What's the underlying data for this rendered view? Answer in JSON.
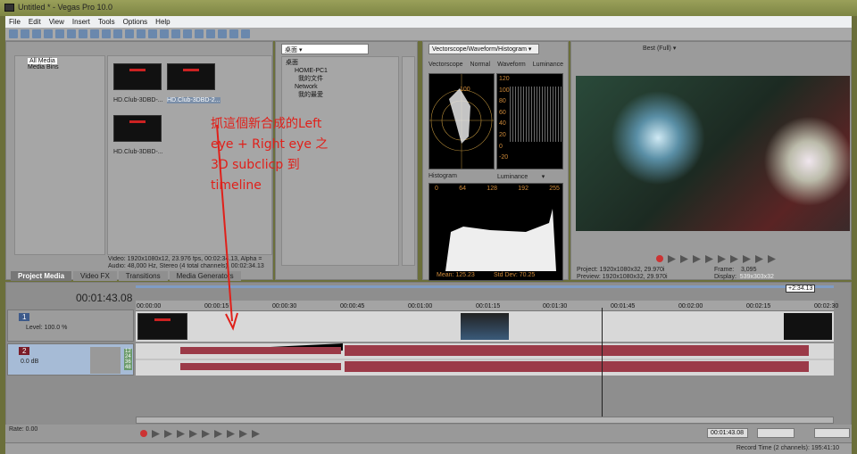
{
  "window": {
    "title": "Untitled * - Vegas Pro 10.0"
  },
  "menu": [
    "File",
    "Edit",
    "View",
    "Insert",
    "Tools",
    "Options",
    "Help"
  ],
  "project_media": {
    "tree": [
      "All Media",
      "Media Bins"
    ],
    "clips": [
      "HD.Club-3DBD-...",
      "HD.Club-3DBD-2...",
      "HD.Club-3DBD-..."
    ],
    "info_video": "Video: 1920x1080x12, 23.976 fps, 00:02:34.13, Alpha =",
    "info_audio": "Audio: 48,000 Hz, Stereo (4 total channels), 00:02:34.13",
    "tabs": [
      "Project Media",
      "Video FX",
      "Transitions",
      "Media Generators"
    ]
  },
  "explorer": {
    "location": "桌面",
    "items": [
      "桌面",
      "HOME-PC1",
      "我的文件",
      "Network",
      "我的最愛"
    ]
  },
  "scopes": {
    "mode": "Vectorscope/Waveform/Histogram",
    "labels": [
      "Vectorscope",
      "Normal",
      "Waveform",
      "Luminance"
    ],
    "vectorscope_label": "100",
    "waveform_scale": [
      "120",
      "100",
      "80",
      "60",
      "40",
      "20",
      "0",
      "-20"
    ],
    "histogram_label": "Histogram",
    "histogram_channel": "Luminance",
    "histogram_scale": [
      "0",
      "64",
      "128",
      "192",
      "255"
    ],
    "mean": "Mean: 125.23",
    "std_dev": "Std Dev: 70.25"
  },
  "preview": {
    "quality": "Best (Full)",
    "project": "Project:  1920x1080x32, 29.970i",
    "preview": "Preview: 1920x1080x32, 29.970i",
    "frame_label": "Frame:",
    "frame": "3,095",
    "display_label": "Display:",
    "display": "539x303x32"
  },
  "annotation": {
    "text": "抓這個新合成的Left eye + Right eye 之 3D subclicp 到 timeline",
    "color": "#e0201a"
  },
  "timeline": {
    "cursor": "00:01:43.08",
    "region_end": "+2:34.13",
    "ticks": [
      "00:00:00",
      "00:00:15",
      "00:00:30",
      "00:00:45",
      "00:01:00",
      "00:01:15",
      "00:01:30",
      "00:01:45",
      "00:02:00",
      "00:02:15",
      "00:02:30"
    ],
    "video_track": {
      "number": "1",
      "level": "Level: 100.0 %"
    },
    "audio_track": {
      "number": "2",
      "volume": "0.0 dB",
      "meter": [
        "12",
        "24",
        "36",
        "48"
      ]
    },
    "audio_color": "#9b3a48"
  },
  "transport": {
    "rate": "Rate: 0.00",
    "time": "00:01:43.08"
  },
  "status": {
    "record_time": "Record Time (2 channels): 195:41:10"
  }
}
